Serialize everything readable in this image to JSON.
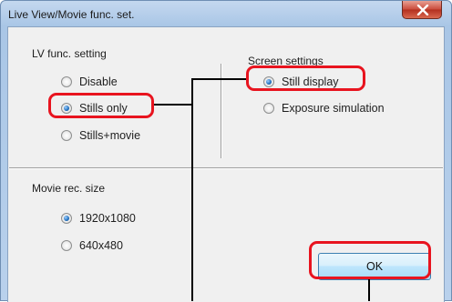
{
  "window": {
    "title": "Live View/Movie func. set."
  },
  "lv_group": {
    "label": "LV func. setting",
    "options": [
      {
        "label": "Disable",
        "checked": false
      },
      {
        "label": "Stills only",
        "checked": true
      },
      {
        "label": "Stills+movie",
        "checked": false
      }
    ]
  },
  "screen_group": {
    "label": "Screen settings",
    "options": [
      {
        "label": "Still display",
        "checked": true
      },
      {
        "label": "Exposure simulation",
        "checked": false
      }
    ]
  },
  "movie_group": {
    "label": "Movie rec. size",
    "options": [
      {
        "label": "1920x1080",
        "checked": true
      },
      {
        "label": "640x480",
        "checked": false
      }
    ]
  },
  "buttons": {
    "ok_label": "OK"
  },
  "colors": {
    "highlight": "#e8141f",
    "title_bar": "#b9d1ec",
    "dialog_bg": "#f0f0f0"
  }
}
